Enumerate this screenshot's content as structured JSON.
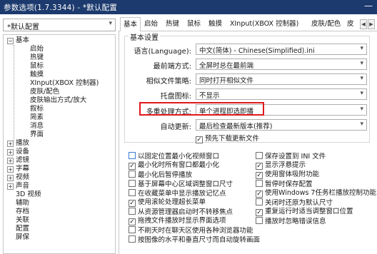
{
  "window": {
    "title": "参数选项(1.7.3344) - *默认配置",
    "minimize_glyph": "—"
  },
  "profile": {
    "selected": "*默认配置",
    "arrow_icon": "chevron-down-icon"
  },
  "tree": {
    "items": [
      {
        "label": "基本",
        "level": 0,
        "expander": "−"
      },
      {
        "label": "启始",
        "level": 1
      },
      {
        "label": "热键",
        "level": 1
      },
      {
        "label": "鼠标",
        "level": 1
      },
      {
        "label": "触摸",
        "level": 1
      },
      {
        "label": "XInput(XBOX 控制器)",
        "level": 1
      },
      {
        "label": "皮肤/配色",
        "level": 1
      },
      {
        "label": "皮肤输出方式/放大",
        "level": 1
      },
      {
        "label": "叙标",
        "level": 1
      },
      {
        "label": "简素",
        "level": 1
      },
      {
        "label": "消息",
        "level": 1
      },
      {
        "label": "界面",
        "level": 1
      },
      {
        "label": "播放",
        "level": 0,
        "expander": "+"
      },
      {
        "label": "设备",
        "level": 0,
        "expander": "+"
      },
      {
        "label": "滤镜",
        "level": 0,
        "expander": "+"
      },
      {
        "label": "字幕",
        "level": 0,
        "expander": "+"
      },
      {
        "label": "视频",
        "level": 0,
        "expander": "+"
      },
      {
        "label": "声音",
        "level": 0,
        "expander": "+"
      },
      {
        "label": "3D 视频",
        "level": 0
      },
      {
        "label": "辅助",
        "level": 0
      },
      {
        "label": "存档",
        "level": 0
      },
      {
        "label": "关联",
        "level": 0
      },
      {
        "label": "配置",
        "level": 0
      },
      {
        "label": "屏保",
        "level": 0
      }
    ]
  },
  "tabs": [
    "基本",
    "启始",
    "热键",
    "鼠标",
    "触摸",
    "XInput(XBOX 控制器)",
    "皮肤/配色",
    "皮"
  ],
  "tab_scroll": {
    "left": "◀",
    "right": "▶"
  },
  "basic": {
    "group_title": "基本设置",
    "rows": [
      {
        "label": "语言(Language):",
        "value": "中文(简体) - Chinese(Simplified).ini"
      },
      {
        "label": "最前端方式:",
        "value": "全屏时总在最前端"
      },
      {
        "label": "相似文件策略:",
        "value": "同时打开相似文件"
      },
      {
        "label": "托盘图标:",
        "value": "不显示"
      },
      {
        "label": "多重处理方式:",
        "value": "单个进程即选即播"
      },
      {
        "label": "自动更新:",
        "value": "最后检查最新版本(推荐)"
      }
    ],
    "update_check": {
      "label": "预先下载更新文件",
      "checked": true
    }
  },
  "options": {
    "left": [
      {
        "label": "以固定位置最小化视频窗口",
        "checked": false,
        "blue": true
      },
      {
        "label": "最小化时所有窗口都最小化",
        "checked": true
      },
      {
        "label": "最小化后暂停播放",
        "checked": false
      },
      {
        "label": "基于屏幕中心区域调整窗口尺寸",
        "checked": false
      },
      {
        "label": "在收藏菜单中显示播放记忆点",
        "checked": false
      },
      {
        "label": "使用滚轮处理超长菜单",
        "checked": true
      },
      {
        "label": "从资源管理器启动时不转移焦点",
        "checked": false
      },
      {
        "label": "拖拽文件播放时显示界面选项",
        "checked": true
      },
      {
        "label": "不刷天时在聊天区使用各种浏览器功能",
        "checked": false
      },
      {
        "label": "按图像的水平和垂直尺寸而自动旋转画面",
        "checked": false
      }
    ],
    "right": [
      {
        "label": "保存设置到 INI 文件",
        "checked": false
      },
      {
        "label": "显示浮悬提示",
        "checked": true
      },
      {
        "label": "使用窗体吸附功能",
        "checked": true
      },
      {
        "label": "暂停时保存配置",
        "checked": false
      },
      {
        "label": "使用Windows 7任务栏播放控制功能",
        "checked": true
      },
      {
        "label": "关闭时还原为默认尺寸",
        "checked": false
      },
      {
        "label": "重复运行时适当调整窗口位置",
        "checked": true
      },
      {
        "label": "播放时忽略错误信息",
        "checked": false
      }
    ]
  },
  "colors": {
    "titlebar": "#1c3a6e",
    "highlight": "#e0181c"
  }
}
